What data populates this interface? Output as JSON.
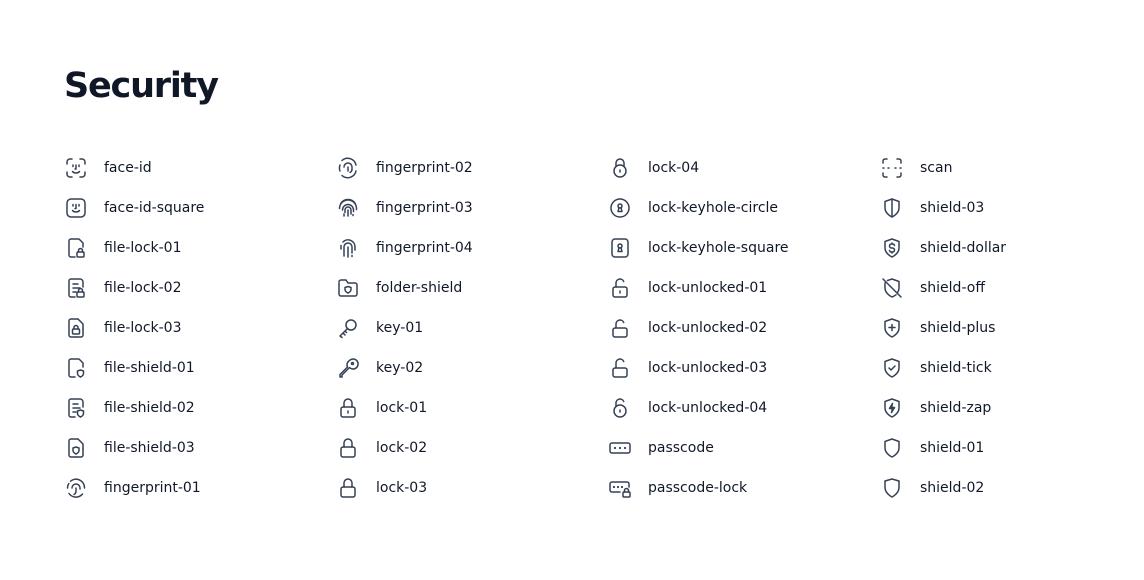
{
  "title": "Security",
  "icons": [
    {
      "label": "face-id",
      "icon": "face-id-icon"
    },
    {
      "label": "face-id-square",
      "icon": "face-id-square-icon"
    },
    {
      "label": "file-lock-01",
      "icon": "file-lock-01-icon"
    },
    {
      "label": "file-lock-02",
      "icon": "file-lock-02-icon"
    },
    {
      "label": "file-lock-03",
      "icon": "file-lock-03-icon"
    },
    {
      "label": "file-shield-01",
      "icon": "file-shield-01-icon"
    },
    {
      "label": "file-shield-02",
      "icon": "file-shield-02-icon"
    },
    {
      "label": "file-shield-03",
      "icon": "file-shield-03-icon"
    },
    {
      "label": "fingerprint-01",
      "icon": "fingerprint-01-icon"
    },
    {
      "label": "fingerprint-02",
      "icon": "fingerprint-02-icon"
    },
    {
      "label": "fingerprint-03",
      "icon": "fingerprint-03-icon"
    },
    {
      "label": "fingerprint-04",
      "icon": "fingerprint-04-icon"
    },
    {
      "label": "folder-shield",
      "icon": "folder-shield-icon"
    },
    {
      "label": "key-01",
      "icon": "key-01-icon"
    },
    {
      "label": "key-02",
      "icon": "key-02-icon"
    },
    {
      "label": "lock-01",
      "icon": "lock-01-icon"
    },
    {
      "label": "lock-02",
      "icon": "lock-02-icon"
    },
    {
      "label": "lock-03",
      "icon": "lock-03-icon"
    },
    {
      "label": "lock-04",
      "icon": "lock-04-icon"
    },
    {
      "label": "lock-keyhole-circle",
      "icon": "lock-keyhole-circle-icon"
    },
    {
      "label": "lock-keyhole-square",
      "icon": "lock-keyhole-square-icon"
    },
    {
      "label": "lock-unlocked-01",
      "icon": "lock-unlocked-01-icon"
    },
    {
      "label": "lock-unlocked-02",
      "icon": "lock-unlocked-02-icon"
    },
    {
      "label": "lock-unlocked-03",
      "icon": "lock-unlocked-03-icon"
    },
    {
      "label": "lock-unlocked-04",
      "icon": "lock-unlocked-04-icon"
    },
    {
      "label": "passcode",
      "icon": "passcode-icon"
    },
    {
      "label": "passcode-lock",
      "icon": "passcode-lock-icon"
    },
    {
      "label": "scan",
      "icon": "scan-icon"
    },
    {
      "label": "shield-03",
      "icon": "shield-03-icon"
    },
    {
      "label": "shield-dollar",
      "icon": "shield-dollar-icon"
    },
    {
      "label": "shield-off",
      "icon": "shield-off-icon"
    },
    {
      "label": "shield-plus",
      "icon": "shield-plus-icon"
    },
    {
      "label": "shield-tick",
      "icon": "shield-tick-icon"
    },
    {
      "label": "shield-zap",
      "icon": "shield-zap-icon"
    },
    {
      "label": "shield-01",
      "icon": "shield-01-icon"
    },
    {
      "label": "shield-02",
      "icon": "shield-02-icon"
    }
  ]
}
